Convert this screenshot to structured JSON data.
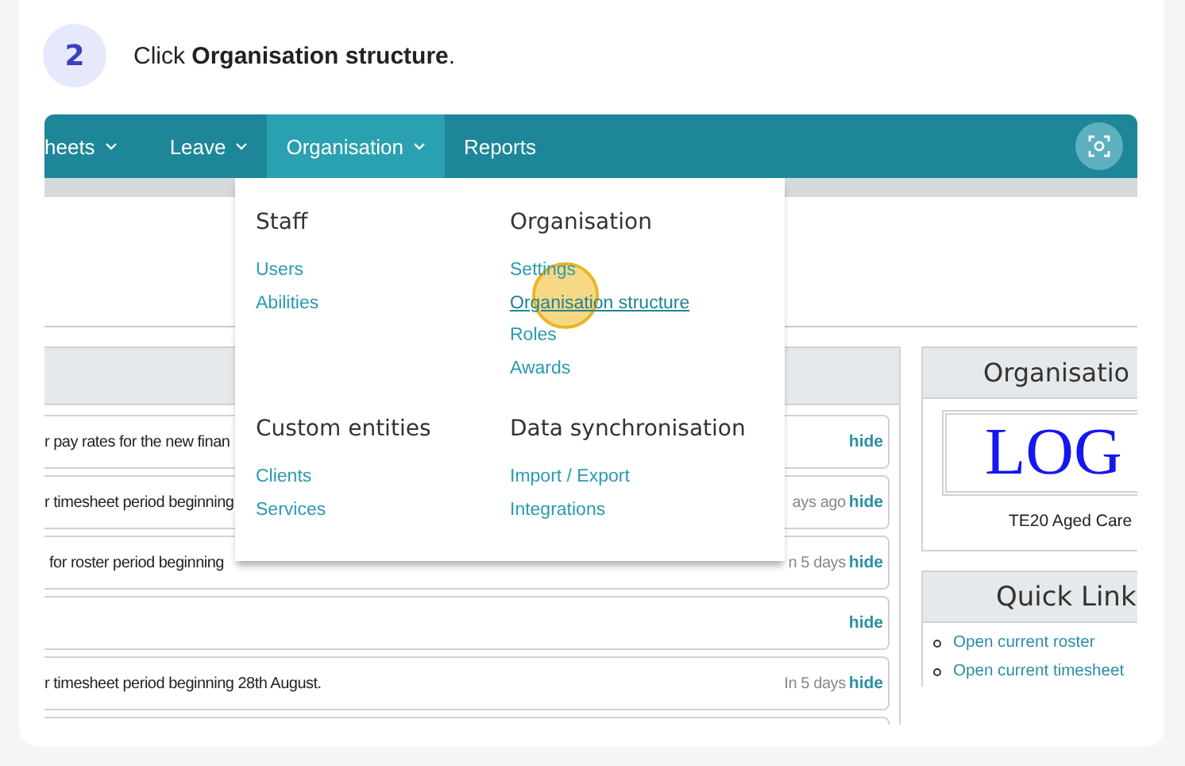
{
  "step": {
    "number": "2",
    "instruction": "Click **Organisation structure**."
  },
  "nav": [
    {
      "label": "heets",
      "dropdown": true,
      "selected": false
    },
    {
      "label": "Leave",
      "dropdown": true,
      "selected": false
    },
    {
      "label": "Organisation",
      "dropdown": true,
      "selected": true
    },
    {
      "label": "Reports",
      "dropdown": false,
      "selected": false
    }
  ],
  "menu": [
    {
      "heading": "Staff",
      "links": [
        {
          "label": "Users",
          "hovered": false
        },
        {
          "label": "Abilities",
          "hovered": false
        }
      ]
    },
    {
      "heading": "Organisation",
      "links": [
        {
          "label": "Settings",
          "hovered": false
        },
        {
          "label": "Organisation structure",
          "hovered": true
        },
        {
          "label": "Roles",
          "hovered": false
        },
        {
          "label": "Awards",
          "hovered": false
        }
      ]
    },
    {
      "heading": "Custom entities",
      "links": [
        {
          "label": "Clients",
          "hovered": false
        },
        {
          "label": "Services",
          "hovered": false
        }
      ]
    },
    {
      "heading": "Data synchronisation",
      "links": [
        {
          "label": "Import / Export",
          "hovered": false
        },
        {
          "label": "Integrations",
          "hovered": false
        }
      ]
    }
  ],
  "notifications": [
    {
      "message": "r pay rates for the new finan",
      "hide": "hide"
    },
    {
      "message": "r timesheet period beginning",
      "time": "ays ago",
      "hide": "hide"
    },
    {
      "message": "for roster period beginning",
      "time": "n 5 days",
      "hide": "hide"
    },
    {
      "hide": "hide"
    },
    {
      "message": "r timesheet period beginning 28th August.",
      "time": "In 5 days",
      "hide": "hide"
    }
  ],
  "organisation_panel": {
    "title": "Organisatio",
    "logo": "LOG",
    "caption": "TE20 Aged Care"
  },
  "quick_links": {
    "title": "Quick Link",
    "links": [
      "Open current roster",
      "Open current timesheet"
    ]
  }
}
